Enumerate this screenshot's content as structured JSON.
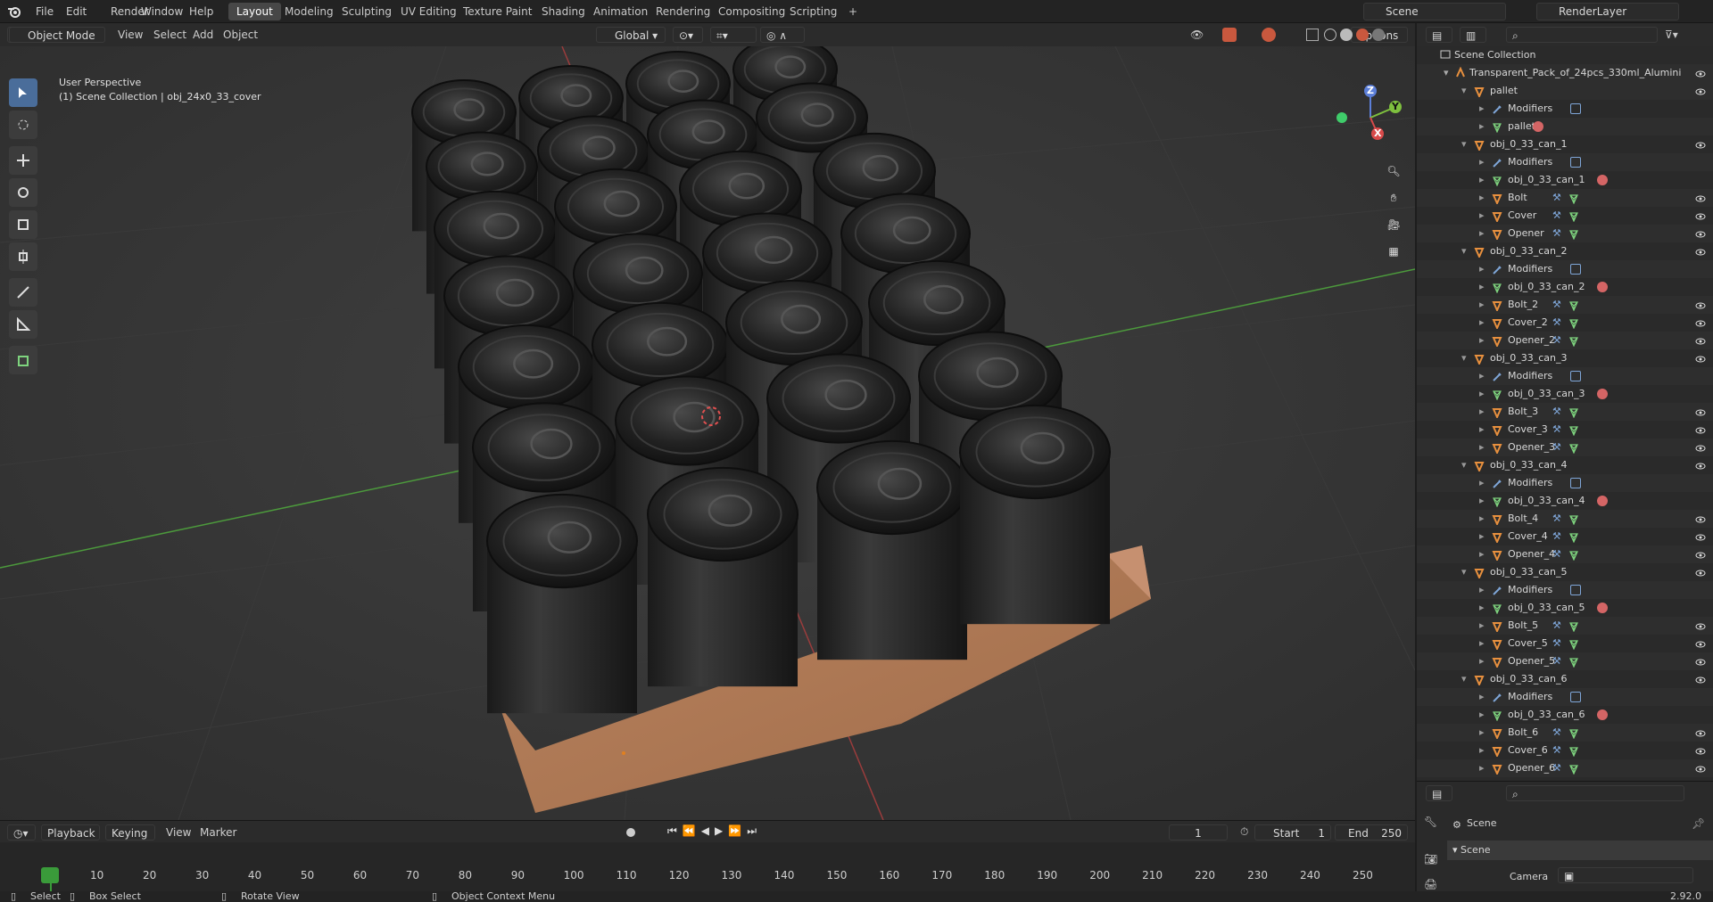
{
  "menu": [
    "File",
    "Edit",
    "Render",
    "Window",
    "Help"
  ],
  "workspaces": [
    {
      "label": "Layout",
      "active": true
    },
    {
      "label": "Modeling"
    },
    {
      "label": "Sculpting"
    },
    {
      "label": "UV Editing"
    },
    {
      "label": "Texture Paint"
    },
    {
      "label": "Shading"
    },
    {
      "label": "Animation"
    },
    {
      "label": "Rendering"
    },
    {
      "label": "Compositing"
    },
    {
      "label": "Scripting"
    }
  ],
  "add_workspace": "+",
  "scene_name": "Scene",
  "view_layer": "RenderLayer",
  "viewport_header": {
    "mode": "Object Mode",
    "view": "View",
    "select": "Select",
    "add": "Add",
    "object": "Object",
    "transform_orientation": "Global",
    "options": "Options"
  },
  "viewport_overlay": {
    "perspective": "User Perspective",
    "collection_info": "(1) Scene Collection | obj_24x0_33_cover"
  },
  "gizmo": {
    "x": "X",
    "y": "Y",
    "z": "Z"
  },
  "outliner": {
    "root": "Scene Collection",
    "collection": "Transparent_Pack_of_24pcs_330ml_Alumini",
    "rows": [
      {
        "indent": 3,
        "label": "pallet",
        "type": "object",
        "expanded": true,
        "eye": true
      },
      {
        "indent": 4,
        "label": "Modifiers",
        "type": "modifiers",
        "eye": false
      },
      {
        "indent": 4,
        "label": "pallet",
        "type": "mesh",
        "eye": false
      },
      {
        "indent": 3,
        "label": "obj_0_33_can_1",
        "type": "object",
        "expanded": true,
        "eye": true
      },
      {
        "indent": 4,
        "label": "Modifiers",
        "type": "modifiers",
        "eye": false
      },
      {
        "indent": 4,
        "label": "obj_0_33_can_1",
        "type": "mesh",
        "eye": false
      },
      {
        "indent": 4,
        "label": "Bolt",
        "type": "object",
        "eye": true
      },
      {
        "indent": 4,
        "label": "Cover",
        "type": "object",
        "eye": true
      },
      {
        "indent": 4,
        "label": "Opener",
        "type": "object",
        "eye": true
      },
      {
        "indent": 3,
        "label": "obj_0_33_can_2",
        "type": "object",
        "expanded": true,
        "eye": true
      },
      {
        "indent": 4,
        "label": "Modifiers",
        "type": "modifiers",
        "eye": false
      },
      {
        "indent": 4,
        "label": "obj_0_33_can_2",
        "type": "mesh",
        "eye": false
      },
      {
        "indent": 4,
        "label": "Bolt_2",
        "type": "object",
        "eye": true
      },
      {
        "indent": 4,
        "label": "Cover_2",
        "type": "object",
        "eye": true
      },
      {
        "indent": 4,
        "label": "Opener_2",
        "type": "object",
        "eye": true
      },
      {
        "indent": 3,
        "label": "obj_0_33_can_3",
        "type": "object",
        "expanded": true,
        "eye": true
      },
      {
        "indent": 4,
        "label": "Modifiers",
        "type": "modifiers",
        "eye": false
      },
      {
        "indent": 4,
        "label": "obj_0_33_can_3",
        "type": "mesh",
        "eye": false
      },
      {
        "indent": 4,
        "label": "Bolt_3",
        "type": "object",
        "eye": true
      },
      {
        "indent": 4,
        "label": "Cover_3",
        "type": "object",
        "eye": true
      },
      {
        "indent": 4,
        "label": "Opener_3",
        "type": "object",
        "eye": true
      },
      {
        "indent": 3,
        "label": "obj_0_33_can_4",
        "type": "object",
        "expanded": true,
        "eye": true
      },
      {
        "indent": 4,
        "label": "Modifiers",
        "type": "modifiers",
        "eye": false
      },
      {
        "indent": 4,
        "label": "obj_0_33_can_4",
        "type": "mesh",
        "eye": false
      },
      {
        "indent": 4,
        "label": "Bolt_4",
        "type": "object",
        "eye": true
      },
      {
        "indent": 4,
        "label": "Cover_4",
        "type": "object",
        "eye": true
      },
      {
        "indent": 4,
        "label": "Opener_4",
        "type": "object",
        "eye": true
      },
      {
        "indent": 3,
        "label": "obj_0_33_can_5",
        "type": "object",
        "expanded": true,
        "eye": true
      },
      {
        "indent": 4,
        "label": "Modifiers",
        "type": "modifiers",
        "eye": false
      },
      {
        "indent": 4,
        "label": "obj_0_33_can_5",
        "type": "mesh",
        "eye": false
      },
      {
        "indent": 4,
        "label": "Bolt_5",
        "type": "object",
        "eye": true
      },
      {
        "indent": 4,
        "label": "Cover_5",
        "type": "object",
        "eye": true
      },
      {
        "indent": 4,
        "label": "Opener_5",
        "type": "object",
        "eye": true
      },
      {
        "indent": 3,
        "label": "obj_0_33_can_6",
        "type": "object",
        "expanded": true,
        "eye": true
      },
      {
        "indent": 4,
        "label": "Modifiers",
        "type": "modifiers",
        "eye": false
      },
      {
        "indent": 4,
        "label": "obj_0_33_can_6",
        "type": "mesh",
        "eye": false
      },
      {
        "indent": 4,
        "label": "Bolt_6",
        "type": "object",
        "eye": true
      },
      {
        "indent": 4,
        "label": "Cover_6",
        "type": "object",
        "eye": true
      },
      {
        "indent": 4,
        "label": "Opener_6",
        "type": "object",
        "eye": true
      }
    ]
  },
  "properties": {
    "scene_label": "Scene",
    "panel_label": "Scene",
    "camera_label": "Camera"
  },
  "timeline": {
    "playback": "Playback",
    "keying": "Keying",
    "view": "View",
    "marker": "Marker",
    "current_frame": "1",
    "start_label": "Start",
    "start": "1",
    "end_label": "End",
    "end": "250",
    "ticks": [
      "1",
      "10",
      "20",
      "30",
      "40",
      "50",
      "60",
      "70",
      "80",
      "90",
      "100",
      "110",
      "120",
      "130",
      "140",
      "150",
      "160",
      "170",
      "180",
      "190",
      "200",
      "210",
      "220",
      "230",
      "240",
      "250"
    ]
  },
  "status": {
    "select": "Select",
    "box_select": "Box Select",
    "rotate": "Rotate View",
    "context_menu": "Object Context Menu",
    "version": "2.92.0"
  },
  "colors": {
    "accent": "#4a6d9a",
    "object_icon": "#e8903e",
    "mesh_icon": "#7ed37e",
    "modifier_icon": "#7fa6d8",
    "material_icon": "#d46565",
    "timeline_current": "#3a9b3a"
  }
}
